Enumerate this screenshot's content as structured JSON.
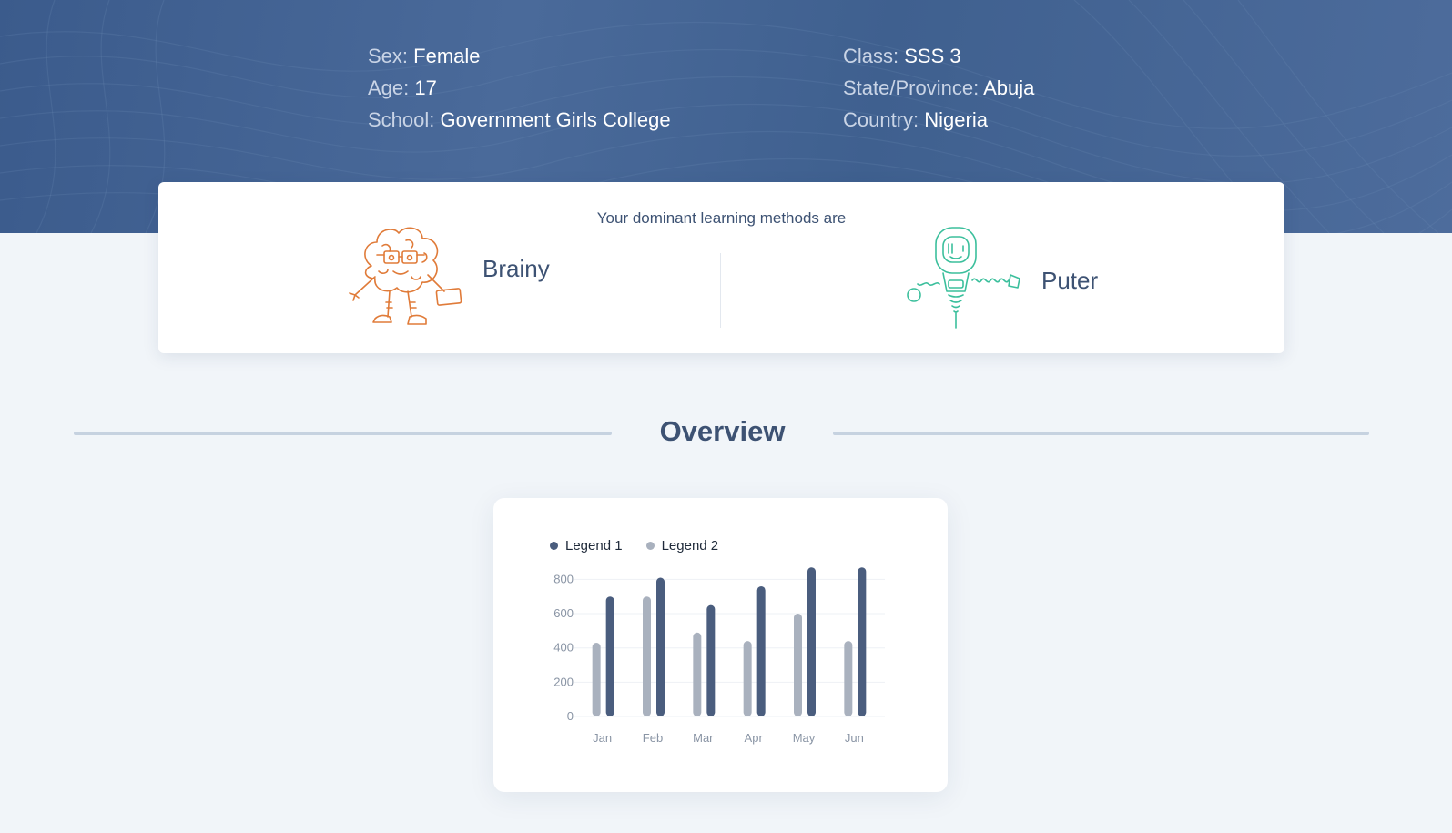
{
  "profile": {
    "left": [
      {
        "label": "Sex:",
        "value": "Female"
      },
      {
        "label": "Age:",
        "value": "17"
      },
      {
        "label": "School:",
        "value": "Government Girls College"
      }
    ],
    "right": [
      {
        "label": "Class:",
        "value": "SSS 3"
      },
      {
        "label": "State/Province:",
        "value": "Abuja"
      },
      {
        "label": "Country:",
        "value": "Nigeria"
      }
    ]
  },
  "learning": {
    "heading": "Your dominant learning methods are",
    "methods": [
      {
        "name": "Brainy",
        "icon": "brain-character-icon",
        "color": "#e07b39"
      },
      {
        "name": "Puter",
        "icon": "robot-character-icon",
        "color": "#3bbf9c"
      }
    ]
  },
  "overview": {
    "title": "Overview"
  },
  "colors": {
    "series1": "#4a5d7e",
    "series2": "#a9b1be",
    "hero": "#3f5f8f"
  },
  "chart_data": {
    "type": "bar",
    "categories": [
      "Jan",
      "Feb",
      "Mar",
      "Apr",
      "May",
      "Jun"
    ],
    "series": [
      {
        "name": "Legend 2",
        "values": [
          430,
          700,
          490,
          440,
          600,
          440
        ]
      },
      {
        "name": "Legend 1",
        "values": [
          700,
          810,
          650,
          760,
          870,
          870
        ]
      }
    ],
    "yticks": [
      0,
      200,
      400,
      600,
      800
    ],
    "ylim": [
      0,
      900
    ],
    "legend_position": "top-left",
    "grid": true
  }
}
